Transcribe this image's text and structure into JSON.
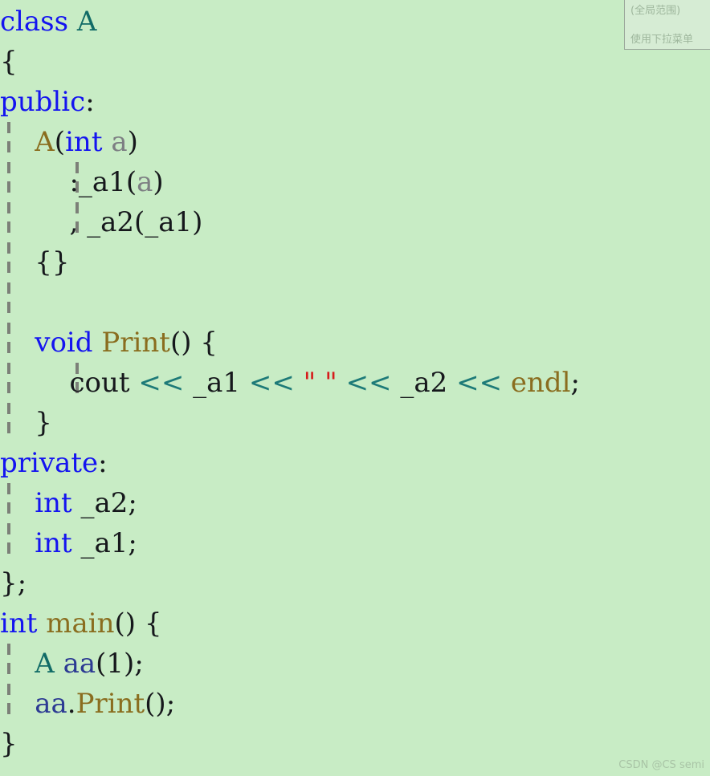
{
  "editor": {
    "background_color": "#c8ecc5",
    "language": "C++",
    "lines": [
      {
        "n": 1,
        "guides": [],
        "tokens": [
          {
            "t": "class ",
            "c": "kw"
          },
          {
            "t": "A",
            "c": "type"
          }
        ]
      },
      {
        "n": 2,
        "guides": [],
        "tokens": [
          {
            "t": "{",
            "c": "plain"
          }
        ]
      },
      {
        "n": 3,
        "guides": [],
        "tokens": [
          {
            "t": "public",
            "c": "kw"
          },
          {
            "t": ":",
            "c": "plain"
          }
        ]
      },
      {
        "n": 4,
        "guides": [
          "g1"
        ],
        "tokens": [
          {
            "t": "    ",
            "c": "plain"
          },
          {
            "t": "A",
            "c": "func"
          },
          {
            "t": "(",
            "c": "plain"
          },
          {
            "t": "int",
            "c": "kw"
          },
          {
            "t": " ",
            "c": "plain"
          },
          {
            "t": "a",
            "c": "param"
          },
          {
            "t": ")",
            "c": "plain"
          }
        ]
      },
      {
        "n": 5,
        "guides": [
          "g1",
          "g2"
        ],
        "tokens": [
          {
            "t": "        :_a1(",
            "c": "plain"
          },
          {
            "t": "a",
            "c": "param"
          },
          {
            "t": ")",
            "c": "plain"
          }
        ]
      },
      {
        "n": 6,
        "guides": [
          "g1",
          "g2"
        ],
        "tokens": [
          {
            "t": "        , _a2(_a1)",
            "c": "plain"
          }
        ]
      },
      {
        "n": 7,
        "guides": [
          "g1"
        ],
        "tokens": [
          {
            "t": "    {}",
            "c": "plain"
          }
        ]
      },
      {
        "n": 8,
        "guides": [
          "g1"
        ],
        "tokens": [
          {
            "t": "",
            "c": "plain"
          }
        ]
      },
      {
        "n": 9,
        "guides": [
          "g1"
        ],
        "tokens": [
          {
            "t": "    ",
            "c": "plain"
          },
          {
            "t": "void",
            "c": "kw"
          },
          {
            "t": " ",
            "c": "plain"
          },
          {
            "t": "Print",
            "c": "func"
          },
          {
            "t": "() {",
            "c": "plain"
          }
        ]
      },
      {
        "n": 10,
        "guides": [
          "g1",
          "g2"
        ],
        "tokens": [
          {
            "t": "        cout ",
            "c": "plain"
          },
          {
            "t": "<<",
            "c": "op"
          },
          {
            "t": " _a1 ",
            "c": "plain"
          },
          {
            "t": "<<",
            "c": "op"
          },
          {
            "t": " ",
            "c": "plain"
          },
          {
            "t": "\" \"",
            "c": "str"
          },
          {
            "t": " ",
            "c": "plain"
          },
          {
            "t": "<<",
            "c": "op"
          },
          {
            "t": " _a2 ",
            "c": "plain"
          },
          {
            "t": "<<",
            "c": "op"
          },
          {
            "t": " ",
            "c": "plain"
          },
          {
            "t": "endl",
            "c": "func"
          },
          {
            "t": ";",
            "c": "plain"
          }
        ]
      },
      {
        "n": 11,
        "guides": [
          "g1"
        ],
        "tokens": [
          {
            "t": "    }",
            "c": "plain"
          }
        ]
      },
      {
        "n": 12,
        "guides": [],
        "tokens": [
          {
            "t": "private",
            "c": "kw"
          },
          {
            "t": ":",
            "c": "plain"
          }
        ]
      },
      {
        "n": 13,
        "guides": [
          "g1"
        ],
        "tokens": [
          {
            "t": "    ",
            "c": "plain"
          },
          {
            "t": "int",
            "c": "kw"
          },
          {
            "t": " _a2;",
            "c": "plain"
          }
        ]
      },
      {
        "n": 14,
        "guides": [
          "g1"
        ],
        "tokens": [
          {
            "t": "    ",
            "c": "plain"
          },
          {
            "t": "int",
            "c": "kw"
          },
          {
            "t": " _a1;",
            "c": "plain"
          }
        ]
      },
      {
        "n": 15,
        "guides": [],
        "tokens": [
          {
            "t": "};",
            "c": "plain"
          }
        ]
      },
      {
        "n": 16,
        "guides": [],
        "tokens": [
          {
            "t": "int",
            "c": "kw"
          },
          {
            "t": " ",
            "c": "plain"
          },
          {
            "t": "main",
            "c": "func"
          },
          {
            "t": "() {",
            "c": "plain"
          }
        ]
      },
      {
        "n": 17,
        "guides": [
          "g1"
        ],
        "tokens": [
          {
            "t": "    ",
            "c": "plain"
          },
          {
            "t": "A",
            "c": "type"
          },
          {
            "t": " ",
            "c": "plain"
          },
          {
            "t": "aa",
            "c": "obj"
          },
          {
            "t": "(1);",
            "c": "plain"
          }
        ]
      },
      {
        "n": 18,
        "guides": [
          "g1"
        ],
        "tokens": [
          {
            "t": "    ",
            "c": "plain"
          },
          {
            "t": "aa",
            "c": "obj"
          },
          {
            "t": ".",
            "c": "plain"
          },
          {
            "t": "Print",
            "c": "func"
          },
          {
            "t": "();",
            "c": "plain"
          }
        ]
      },
      {
        "n": 19,
        "guides": [],
        "tokens": [
          {
            "t": "}",
            "c": "plain"
          }
        ]
      }
    ],
    "plain_text": "class A\n{\npublic:\n    A(int a)\n        :_a1(a)\n        , _a2(_a1)\n    {}\n\n    void Print() {\n        cout << _a1 << \" \" << _a2 << endl;\n    }\nprivate:\n    int _a2;\n    int _a1;\n};\nint main() {\n    A aa(1);\n    aa.Print();\n}"
  },
  "tooltip": {
    "scope_label": "(全局范围)",
    "hint_label": "使用下拉菜单"
  },
  "watermark": {
    "text": "CSDN @CS semi"
  },
  "colors": {
    "background": "#c8ecc5",
    "keyword": "#1414f0",
    "type": "#116b67",
    "function": "#8a6d1f",
    "parameter": "#7d7f83",
    "operator": "#1d7a78",
    "string": "#d61b1b",
    "object": "#2c3a93",
    "plain": "#16181c",
    "indent_guide": "#7c8078",
    "tooltip_background": "#d6ecd4",
    "tooltip_text": "#9fb79d",
    "watermark_text": "#a9c4a6"
  }
}
